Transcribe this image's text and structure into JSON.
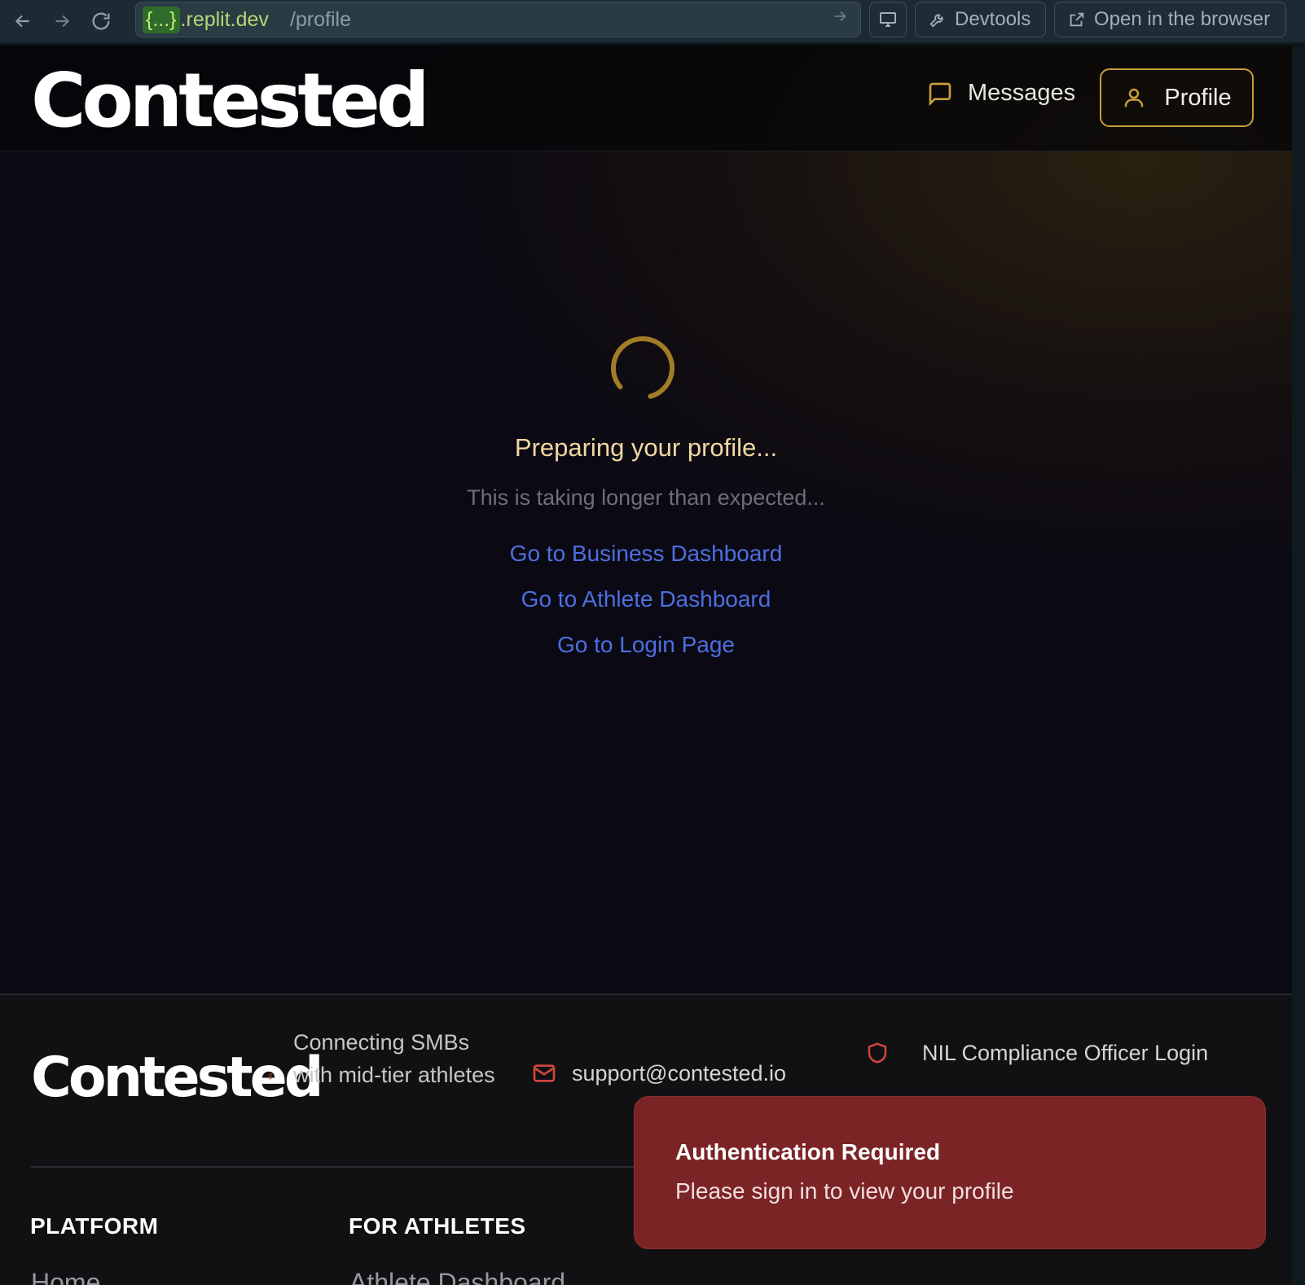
{
  "browser": {
    "back_icon": "arrow-left-icon",
    "forward_icon": "arrow-right-icon",
    "reload_icon": "reload-icon",
    "url_badge": "{...}",
    "url_host": ".replit.dev",
    "url_path": "/profile",
    "devtools_label": "Devtools",
    "open_browser_label": "Open in the browser"
  },
  "header": {
    "logo": "Contested",
    "messages_label": "Messages",
    "profile_label": "Profile",
    "accent_color": "#c89e3a"
  },
  "main": {
    "status_title": "Preparing your profile...",
    "status_subtitle": "This is taking longer than expected...",
    "links": [
      {
        "label": "Go to Business Dashboard"
      },
      {
        "label": "Go to Athlete Dashboard"
      },
      {
        "label": "Go to Login Page"
      }
    ],
    "link_color": "#4d6fe0"
  },
  "footer": {
    "logo": "Contested",
    "tagline": "Connecting SMBs with mid-tier athletes",
    "support_email": "support@contested.io",
    "nil_login": "NIL Compliance Officer Login",
    "columns": [
      {
        "heading": "PLATFORM",
        "first_item": "Home"
      },
      {
        "heading": "FOR ATHLETES",
        "first_item": "Athlete Dashboard"
      }
    ]
  },
  "toast": {
    "title": "Authentication Required",
    "message": "Please sign in to view your profile",
    "color": "#7b2426"
  }
}
